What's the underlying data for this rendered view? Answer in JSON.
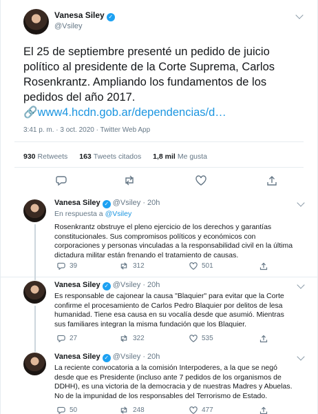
{
  "main": {
    "name": "Vanesa Siley",
    "handle": "@Vsiley",
    "text": "El 25 de septiembre presenté un pedido de juicio político al presidente de la Corte Suprema, Carlos Rosenkrantz. Ampliando los fundamentos de los pedidos del año 2017.",
    "link_emoji": "🔗",
    "link": "www4.hcdn.gob.ar/dependencias/d…",
    "timestamp": "3:41 p. m. · 3 oct. 2020 · Twitter Web App",
    "retweets_count": "930",
    "retweets_label": "Retweets",
    "quotes_count": "163",
    "quotes_label": "Tweets citados",
    "likes_count": "1,8 mil",
    "likes_label": "Me gusta"
  },
  "replies": [
    {
      "name": "Vanesa Siley",
      "handle": "@Vsiley",
      "time": "· 20h",
      "in_reply_prefix": "En respuesta a",
      "in_reply_handle": "@Vsiley",
      "text": "Rosenkrantz obstruye el pleno ejercicio de los derechos y garantías constitucionales. Sus compromisos políticos y económicos con corporaciones y personas vinculadas a la responsabilidad civil en la última dictadura militar están frenando el tratamiento de causas.",
      "replies": "39",
      "retweets": "312",
      "likes": "501"
    },
    {
      "name": "Vanesa Siley",
      "handle": "@Vsiley",
      "time": "· 20h",
      "text": "Es responsable de cajonear la causa \"Blaquier\" para evitar que la Corte confirme el procesamiento de Carlos Pedro Blaquier por delitos de lesa humanidad. Tiene esa causa en su vocalía desde que asumió. Mientras sus familiares integran la misma fundación que los Blaquier.",
      "replies": "27",
      "retweets": "322",
      "likes": "535"
    },
    {
      "name": "Vanesa Siley",
      "handle": "@Vsiley",
      "time": "· 20h",
      "text": "La reciente convocatoria a la comisión Interpoderes, a la que se negó desde que es Presidente (incluso ante 7 pedidos de los organismos de DDHH), es una victoria de la democracia y de nuestras Madres y Abuelas. No de la impunidad de los responsables del Terrorismo de Estado.",
      "replies": "50",
      "retweets": "248",
      "likes": "477"
    }
  ],
  "icons": [
    "reply-icon",
    "retweet-icon",
    "like-icon",
    "share-icon",
    "chevron-down-icon",
    "verified-icon"
  ],
  "colors": {
    "link": "#1b95e0",
    "verified": "#1da1f2",
    "secondary_text": "#657786",
    "border": "#e6ecf0"
  }
}
